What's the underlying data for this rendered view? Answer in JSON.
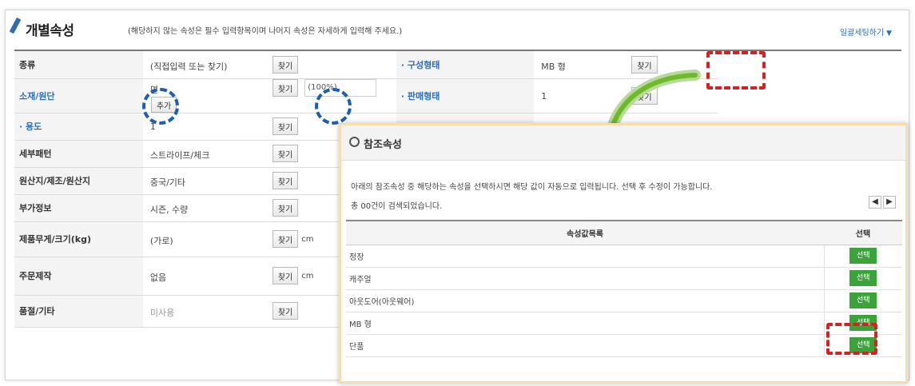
{
  "header": {
    "title": "개별속성",
    "description_prefix": "(해당하지 않는 속성은 필수 입력항목이며 나머지 속성은 자세하게 입력해 주세요.)",
    "batch_link": "일괄세팅하기",
    "batch_link_arrow": "▼"
  },
  "attributes": {
    "rows": [
      {
        "label": "종류",
        "value": "(직접입력 또는 찾기)",
        "button": "찾기"
      },
      {
        "label": "소재/원단",
        "value": "면",
        "button": "찾기",
        "extra_value": "(100%)",
        "extra_button": "추가"
      },
      {
        "label": "· 용도",
        "value": "1",
        "button": "찾기"
      },
      {
        "label": "세부패턴",
        "value": "스트라이프/체크",
        "button": "찾기"
      },
      {
        "label": "원산지/제조/원산지",
        "value": "중국/기타",
        "button": "찾기"
      },
      {
        "label": "부가정보",
        "value": "시즌, 수량",
        "button": "찾기"
      },
      {
        "label": "제품무게/크기(kg)",
        "value": "(가로)",
        "button": "찾기",
        "trail": "cm"
      },
      {
        "label": "주문제작",
        "value": "없음",
        "button": "찾기",
        "trail": "cm"
      },
      {
        "label": "품절/기타",
        "value": "미사용",
        "button": "찾기"
      }
    ],
    "right_rows": [
      {
        "label": "· 구성형태",
        "value": "MB 형",
        "button": "찾기"
      },
      {
        "label": "· 판매형태",
        "value": "1",
        "button": "찾기"
      }
    ]
  },
  "popup": {
    "title": "참조속성",
    "note1": "아래의 참조속성 중 해당하는 속성을 선택하시면 해당 값이 자동으로 입력됩니다. 선택 후 수정이 가능합니다.",
    "note2": "총 00건이 검색되었습니다.",
    "pager": [
      "◀",
      "▶"
    ],
    "table": {
      "col_name": "속성값목록",
      "col_select": "선택",
      "rows": [
        {
          "name": "정장",
          "button": "선택"
        },
        {
          "name": "캐주얼",
          "button": "선택"
        },
        {
          "name": "아웃도어(아웃웨어)",
          "button": "선택"
        },
        {
          "name": "MB 형",
          "button": "선택"
        },
        {
          "name": "단품",
          "button": "선택"
        }
      ]
    }
  },
  "colors": {
    "accent_blue": "#2f6db5",
    "highlight_red": "#d9201f",
    "select_green": "#3aa43a",
    "arrow_green": "#6dbb2b"
  }
}
